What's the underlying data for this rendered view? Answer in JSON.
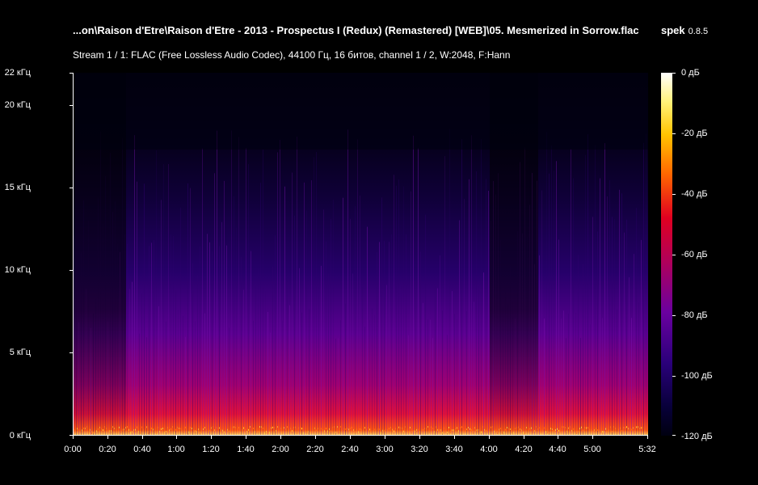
{
  "header": {
    "file_title": "...on\\Raison d'Etre\\Raison d'Etre - 2013 - Prospectus I (Redux) (Remastered) [WEB]\\05. Mesmerized in Sorrow.flac",
    "app_name": "spek",
    "app_version": "0.8.5",
    "stream_info": "Stream 1 / 1: FLAC (Free Lossless Audio Codec), 44100 Гц, 16 битов, channel 1 / 2, W:2048, F:Hann"
  },
  "y_axis": {
    "labels": [
      "22 кГц",
      "20 кГц",
      "15 кГц",
      "10 кГц",
      "5 кГц",
      "0 кГц"
    ]
  },
  "x_axis": {
    "labels": [
      "0:00",
      "0:20",
      "0:40",
      "1:00",
      "1:20",
      "1:40",
      "2:00",
      "2:20",
      "2:40",
      "3:00",
      "3:20",
      "3:40",
      "4:00",
      "4:20",
      "4:40",
      "5:00",
      "5:32"
    ]
  },
  "colorbar": {
    "labels": [
      "0 дБ",
      "-20 дБ",
      "-40 дБ",
      "-60 дБ",
      "-80 дБ",
      "-100 дБ",
      "-120 дБ"
    ]
  }
}
